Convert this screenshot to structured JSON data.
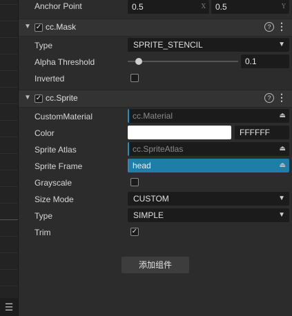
{
  "anchor": {
    "label": "Anchor Point",
    "x": "0.5",
    "y": "0.5",
    "x_axis": "X",
    "y_axis": "Y"
  },
  "mask": {
    "title": "cc.Mask",
    "type_label": "Type",
    "type_value": "SPRITE_STENCIL",
    "alpha_label": "Alpha Threshold",
    "alpha_value": "0.1",
    "alpha_fraction": 0.1,
    "inverted_label": "Inverted"
  },
  "sprite": {
    "title": "cc.Sprite",
    "custom_material_label": "CustomMaterial",
    "custom_material_value": "cc.Material",
    "color_label": "Color",
    "color_hex": "FFFFFF",
    "color_value": "#ffffff",
    "atlas_label": "Sprite Atlas",
    "atlas_value": "cc.SpriteAtlas",
    "frame_label": "Sprite Frame",
    "frame_value": "head",
    "grayscale_label": "Grayscale",
    "size_mode_label": "Size Mode",
    "size_mode_value": "CUSTOM",
    "type_label": "Type",
    "type_value": "SIMPLE",
    "trim_label": "Trim"
  },
  "add_component": "添加组件",
  "icons": {
    "help": "?",
    "more": "⋮",
    "menu": "☰",
    "chevron": "▼",
    "lock": "⏏"
  },
  "colors": {
    "accent": "#2a8bbf",
    "frame_fill": "#1f7ea8"
  }
}
